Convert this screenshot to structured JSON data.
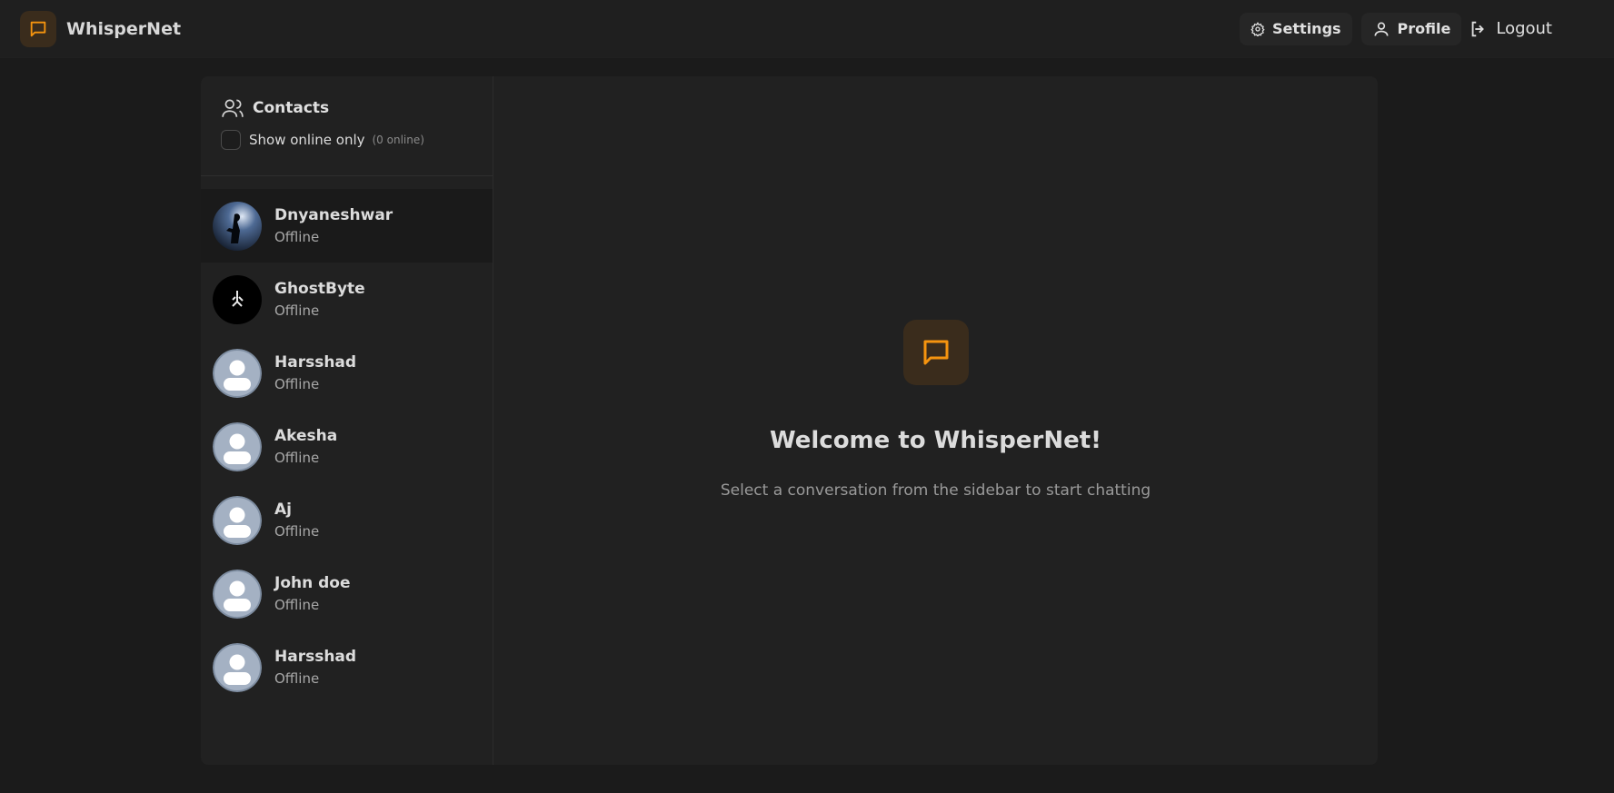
{
  "header": {
    "brand": "WhisperNet",
    "settings_label": "Settings",
    "profile_label": "Profile",
    "logout_label": "Logout"
  },
  "sidebar": {
    "title": "Contacts",
    "filter_label": "Show online only",
    "online_count": "(0 online)",
    "contacts": [
      {
        "name": "Dnyaneshwar",
        "status": "Offline"
      },
      {
        "name": "GhostByte",
        "status": "Offline"
      },
      {
        "name": "Harsshad",
        "status": "Offline"
      },
      {
        "name": "Akesha",
        "status": "Offline"
      },
      {
        "name": "Aj",
        "status": "Offline"
      },
      {
        "name": "John doe",
        "status": "Offline"
      },
      {
        "name": "Harsshad",
        "status": "Offline"
      }
    ]
  },
  "main": {
    "welcome_title": "Welcome to WhisperNet!",
    "welcome_subtitle": "Select a conversation from the sidebar to start chatting"
  },
  "colors": {
    "accent": "#f5940f",
    "accent_bg": "#3a2c1c",
    "background": "#1b1b1b",
    "panel": "#212121"
  }
}
